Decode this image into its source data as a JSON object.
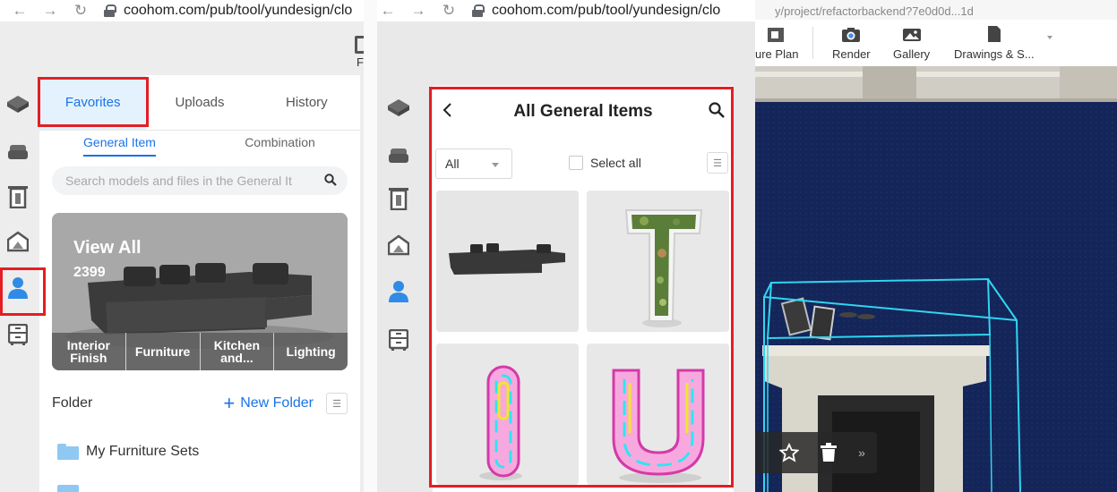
{
  "browser": {
    "url": "coohom.com/pub/tool/yundesign/clo",
    "url_right": "y/project/refactorbackend?7e0d0d...1d"
  },
  "left_panel": {
    "tabs": [
      {
        "label": "Favorites",
        "active": true
      },
      {
        "label": "Uploads",
        "active": false
      },
      {
        "label": "History",
        "active": false
      }
    ],
    "subtabs": [
      {
        "label": "General Item",
        "active": true
      },
      {
        "label": "Combination",
        "active": false
      }
    ],
    "search_placeholder": "Search models and files in the General It",
    "view_all": {
      "title": "View All",
      "count": "2399",
      "categories": [
        "Interior Finish",
        "Furniture",
        "Kitchen and...",
        "Lighting"
      ]
    },
    "folder_label": "Folder",
    "new_folder": "New Folder",
    "folders": [
      "My Furniture Sets"
    ],
    "partial_label": "F"
  },
  "middle_panel": {
    "title": "All General Items",
    "filter_value": "All",
    "select_all": "Select all"
  },
  "right_toolbar": {
    "items": [
      "ure Plan",
      "Render",
      "Gallery",
      "Drawings & S..."
    ]
  },
  "colors": {
    "accent": "#1a73e8",
    "highlight": "#e31e24",
    "active_tab_bg": "#e3f2fd",
    "scene_wall": "#142559",
    "selection_box": "#30d5f0"
  }
}
